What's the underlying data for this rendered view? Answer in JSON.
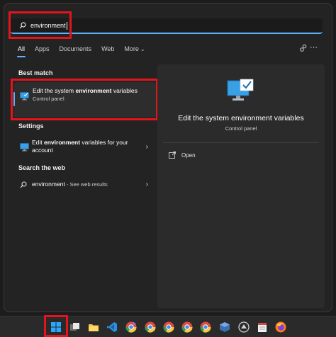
{
  "search": {
    "query": "environment"
  },
  "tabs": [
    "All",
    "Apps",
    "Documents",
    "Web",
    "More"
  ],
  "sections": {
    "best_match": "Best match",
    "settings": "Settings",
    "search_web": "Search the web"
  },
  "best_match": {
    "title_plain": "Edit the system ",
    "title_bold": "environment",
    "title_rest": " variables",
    "subtitle": "Control panel"
  },
  "settings_item": {
    "pre": "Edit ",
    "bold": "environment",
    "post": " variables for your account"
  },
  "web_item": {
    "query": "environment",
    "suffix": " - See web results"
  },
  "detail": {
    "title": "Edit the system environment variables",
    "subtitle": "Control panel",
    "open_label": "Open"
  },
  "taskbar": [
    "start",
    "task-view",
    "file-explorer",
    "vscode",
    "chrome-profile",
    "chrome",
    "chrome",
    "chrome",
    "chrome",
    "virtualbox",
    "app",
    "notepad",
    "firefox"
  ],
  "colors": {
    "accent": "#5fb2ff",
    "highlight": "#e3141b",
    "panel": "#232323"
  }
}
